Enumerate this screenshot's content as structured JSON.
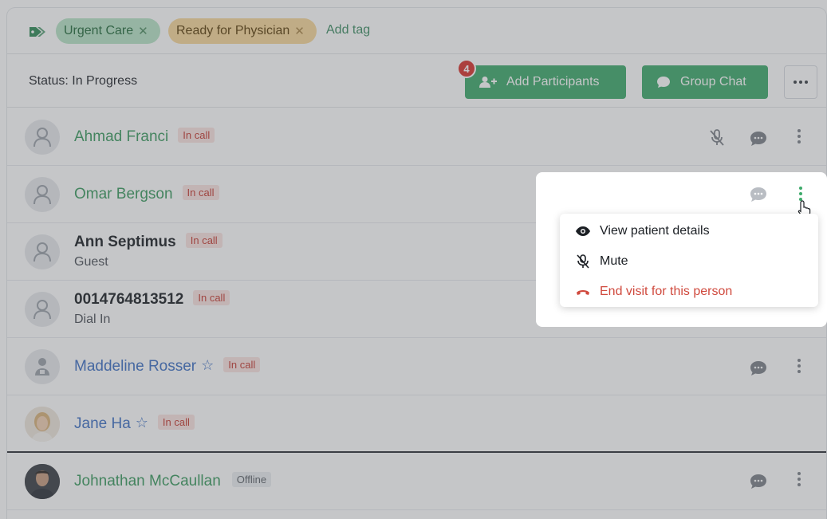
{
  "tags": [
    {
      "label": "Urgent Care",
      "color": "#b7e4c6"
    },
    {
      "label": "Ready for Physician",
      "color": "#f7d89a"
    }
  ],
  "add_tag_label": "Add tag",
  "status": {
    "text": "Status: In Progress"
  },
  "toolbar": {
    "add_participants_label": "Add Participants",
    "add_participants_badge": "4",
    "group_chat_label": "Group Chat"
  },
  "participants": [
    {
      "name": "Ahmad Franci",
      "status": "In call",
      "sub": "",
      "name_color": "green"
    },
    {
      "name": "Omar Bergson",
      "status": "In call",
      "sub": "",
      "name_color": "green"
    },
    {
      "name": "Ann Septimus",
      "status": "In call",
      "sub": "Guest",
      "name_color": "dark"
    },
    {
      "name": "0014764813512",
      "status": "In call",
      "sub": "Dial In",
      "name_color": "dark"
    },
    {
      "name": "Maddeline Rosser",
      "status": "In call",
      "sub": "",
      "name_color": "blue"
    },
    {
      "name": "Jane Ha",
      "status": "In call",
      "sub": "",
      "name_color": "blue"
    },
    {
      "name": "Johnathan McCaullan",
      "status": "Offline",
      "sub": "",
      "name_color": "green"
    }
  ],
  "context_menu": {
    "items": [
      {
        "label": "View patient details",
        "icon": "eye-icon"
      },
      {
        "label": "Mute",
        "icon": "mic-off-icon"
      },
      {
        "label": "End visit for this person",
        "icon": "hang-up-icon"
      }
    ]
  },
  "colors": {
    "accent": "#3daa6a",
    "name_green": "#3a9a5f",
    "name_blue": "#3d6fc4",
    "danger": "#d04a3e"
  }
}
